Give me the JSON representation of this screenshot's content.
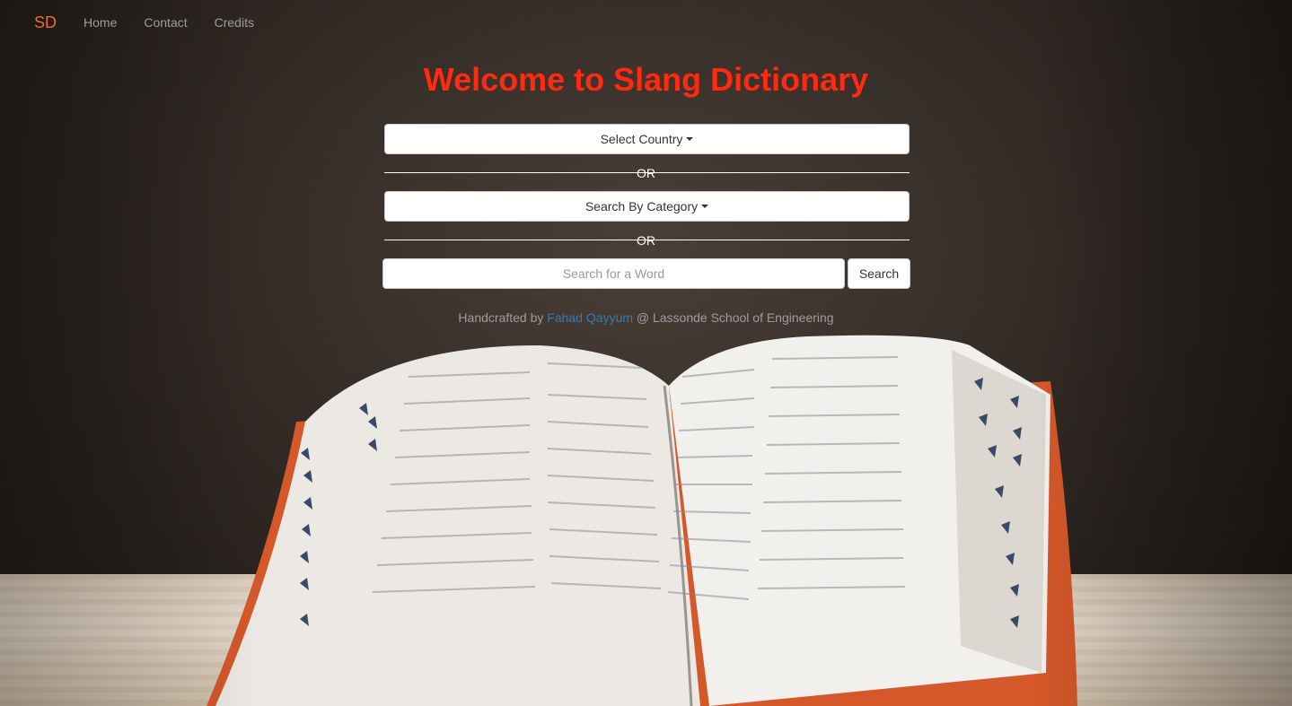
{
  "nav": {
    "brand": "SD",
    "links": [
      "Home",
      "Contact",
      "Credits"
    ]
  },
  "hero": {
    "title": "Welcome to Slang Dictionary"
  },
  "controls": {
    "select_country_label": "Select Country",
    "or_label": "OR",
    "category_label": "Search By Category",
    "search_placeholder": "Search for a Word",
    "search_button": "Search"
  },
  "footer": {
    "prefix": "Handcrafted by",
    "author": "Fahad Qayyum",
    "suffix": "@ Lassonde School of Engineering"
  },
  "colors": {
    "brand": "#f06a2c",
    "title": "#ff2a10",
    "link": "#337ab7"
  },
  "background_image": "open-dictionary-book-on-wooden-table"
}
